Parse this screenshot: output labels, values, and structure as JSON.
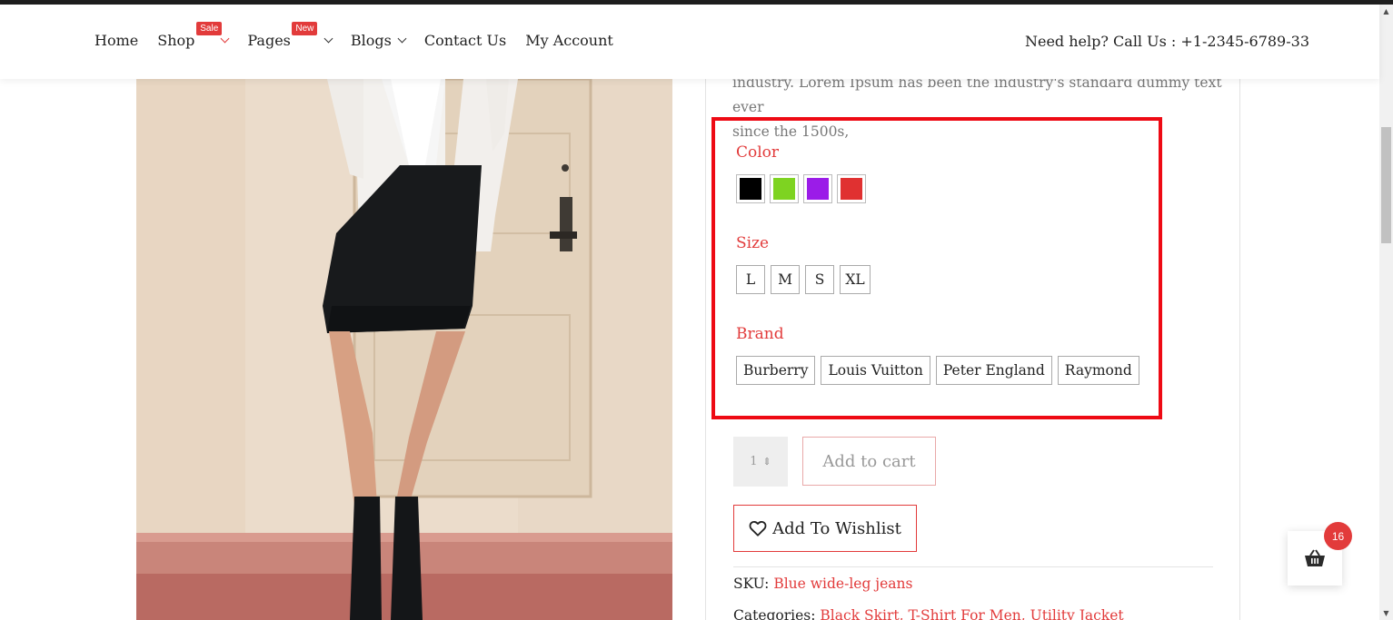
{
  "nav": {
    "items": [
      {
        "label": "Home"
      },
      {
        "label": "Shop",
        "badge": "Sale"
      },
      {
        "label": "Pages",
        "badge": "New"
      },
      {
        "label": "Blogs"
      },
      {
        "label": "Contact Us"
      },
      {
        "label": "My Account"
      }
    ],
    "help": "Need help? Call Us : +1-2345-6789-33"
  },
  "product": {
    "description_line1": "industry. Lorem Ipsum has been the industry's standard dummy text ever",
    "description_line2": "since the 1500s,",
    "variations": {
      "color_label": "Color",
      "colors": [
        "#000000",
        "#7ed321",
        "#9b1ce8",
        "#e03131"
      ],
      "size_label": "Size",
      "sizes": [
        "L",
        "M",
        "S",
        "XL"
      ],
      "brand_label": "Brand",
      "brands": [
        "Burberry",
        "Louis Vuitton",
        "Peter England",
        "Raymond"
      ]
    },
    "quantity": "1",
    "add_to_cart": "Add to cart",
    "wishlist": "Add To Wishlist",
    "sku_label": "SKU:",
    "sku_value": "Blue wide-leg jeans",
    "categories_label": "Categories:",
    "categories_value": "Black Skirt, T-Shirt For Men, Utility Jacket"
  },
  "cart": {
    "count": "16"
  },
  "colors": {
    "accent": "#e23b3b",
    "highlight": "#ee0a14"
  }
}
